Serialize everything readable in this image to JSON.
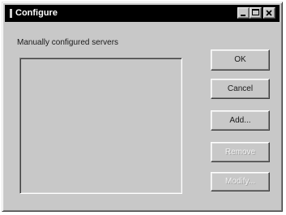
{
  "window": {
    "title": "Configure",
    "caption_buttons": [
      "minimize-icon",
      "maximize-icon",
      "close-icon"
    ]
  },
  "main": {
    "group_label": "Manually configured servers",
    "server_list": {
      "items": []
    }
  },
  "buttons": {
    "ok": "OK",
    "cancel": "Cancel",
    "add": "Add...",
    "remove": "Remove",
    "modify": "Modify..."
  },
  "colors": {
    "dialog_background": "#c8c8c8",
    "titlebar": "#000000",
    "title_text": "#ffffff",
    "disabled_text": "#f2f2f2"
  }
}
